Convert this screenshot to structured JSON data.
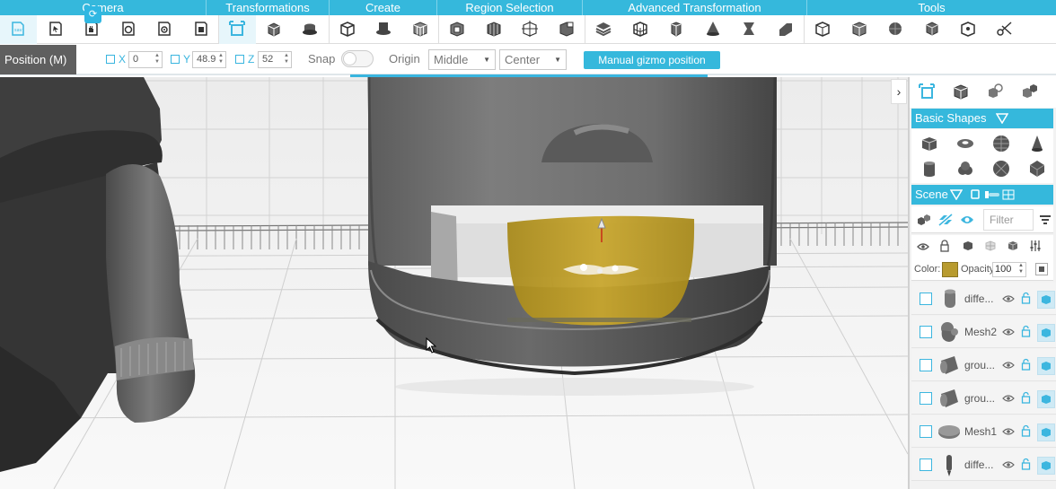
{
  "toolbar": {
    "groups": [
      {
        "label": "Camera"
      },
      {
        "label": "Transformations"
      },
      {
        "label": "Create"
      },
      {
        "label": "Region Selection"
      },
      {
        "label": "Advanced Transformation"
      },
      {
        "label": "Tools"
      }
    ]
  },
  "position_bar": {
    "label": "Position (M)",
    "x_label": "X",
    "x_value": "0",
    "y_label": "Y",
    "y_value": "48.9",
    "z_label": "Z",
    "z_value": "52",
    "snap_label": "Snap",
    "snap_on": false,
    "origin_label": "Origin",
    "origin_vertical": "Middle",
    "origin_horizontal": "Center",
    "manual_gizmo_label": "Manual gizmo position"
  },
  "panel": {
    "basic_shapes_label": "Basic Shapes",
    "scene_label": "Scene",
    "filter_placeholder": "Filter",
    "color_label": "Color:",
    "opacity_label": "Opacity:",
    "opacity_value": "100",
    "selected_color": "#b89b2f",
    "meshes": [
      {
        "name": "diffe...",
        "icon": "cylinder-mesh-icon"
      },
      {
        "name": "Mesh2",
        "icon": "bear-mesh-icon"
      },
      {
        "name": "grou...",
        "icon": "tube-mesh-icon"
      },
      {
        "name": "grou...",
        "icon": "tube-mesh-icon"
      },
      {
        "name": "Mesh1",
        "icon": "disc-mesh-icon"
      },
      {
        "name": "diffe...",
        "icon": "pin-mesh-icon"
      }
    ]
  },
  "colors": {
    "accent": "#35b8dc",
    "selection": "#b89b2f"
  }
}
